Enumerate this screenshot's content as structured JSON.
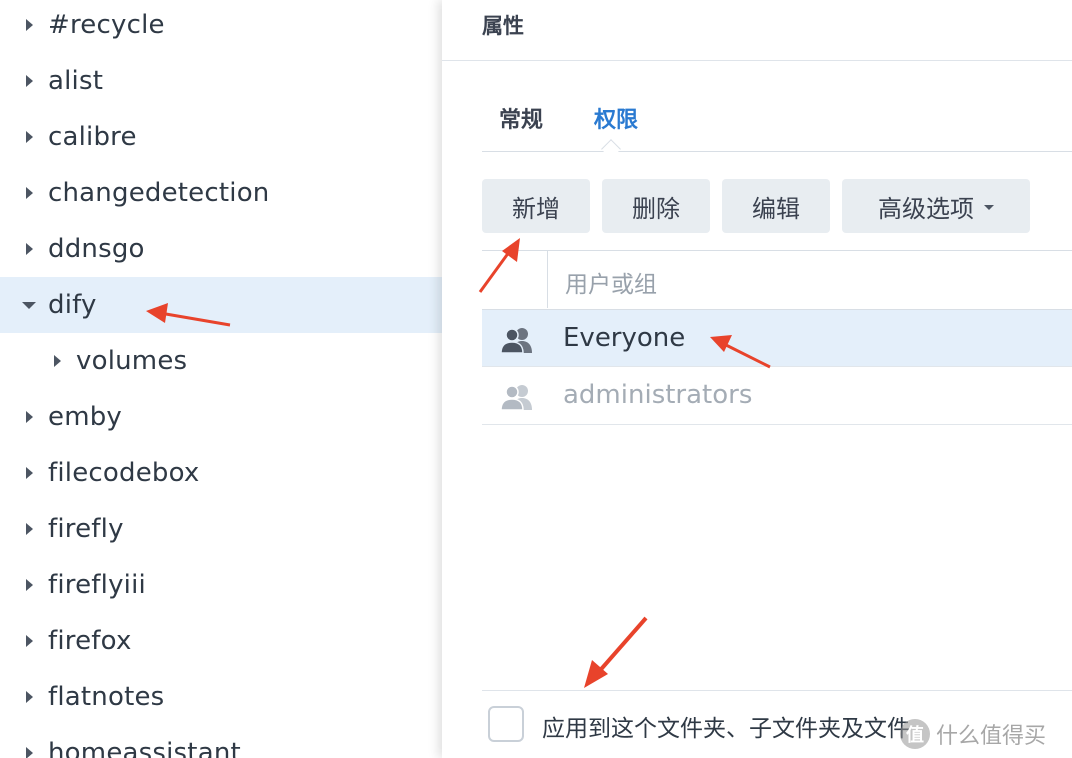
{
  "tree": {
    "items": [
      {
        "label": "#recycle",
        "expanded": false,
        "level": 0
      },
      {
        "label": "alist",
        "expanded": false,
        "level": 0
      },
      {
        "label": "calibre",
        "expanded": false,
        "level": 0
      },
      {
        "label": "changedetection",
        "expanded": false,
        "level": 0
      },
      {
        "label": "ddnsgo",
        "expanded": false,
        "level": 0
      },
      {
        "label": "dify",
        "expanded": true,
        "selected": true,
        "level": 0
      },
      {
        "label": "volumes",
        "expanded": false,
        "level": 1
      },
      {
        "label": "emby",
        "expanded": false,
        "level": 0
      },
      {
        "label": "filecodebox",
        "expanded": false,
        "level": 0
      },
      {
        "label": "firefly",
        "expanded": false,
        "level": 0
      },
      {
        "label": "fireflyiii",
        "expanded": false,
        "level": 0
      },
      {
        "label": "firefox",
        "expanded": false,
        "level": 0
      },
      {
        "label": "flatnotes",
        "expanded": false,
        "level": 0
      },
      {
        "label": "homeassistant",
        "expanded": false,
        "level": 0
      }
    ]
  },
  "dialog": {
    "title": "属性",
    "tabs": {
      "general": "常规",
      "permissions": "权限",
      "active": "permissions"
    },
    "toolbar": {
      "add": "新增",
      "delete": "删除",
      "edit": "编辑",
      "advanced": "高级选项"
    },
    "table": {
      "column_header": "用户或组",
      "rows": [
        {
          "name": "Everyone",
          "icon": "user-group-icon",
          "selected": true,
          "enabled": true
        },
        {
          "name": "administrators",
          "icon": "user-group-icon",
          "selected": false,
          "enabled": false
        }
      ]
    },
    "apply_checkbox": {
      "label": "应用到这个文件夹、子文件夹及文件",
      "checked": false
    }
  },
  "watermark": {
    "badge": "值",
    "text": "什么值得买"
  },
  "colors": {
    "accent": "#2a7ad1",
    "selected_row": "#e4effa",
    "button_bg": "#e8edf1",
    "annotation_arrow": "#e8432b"
  }
}
